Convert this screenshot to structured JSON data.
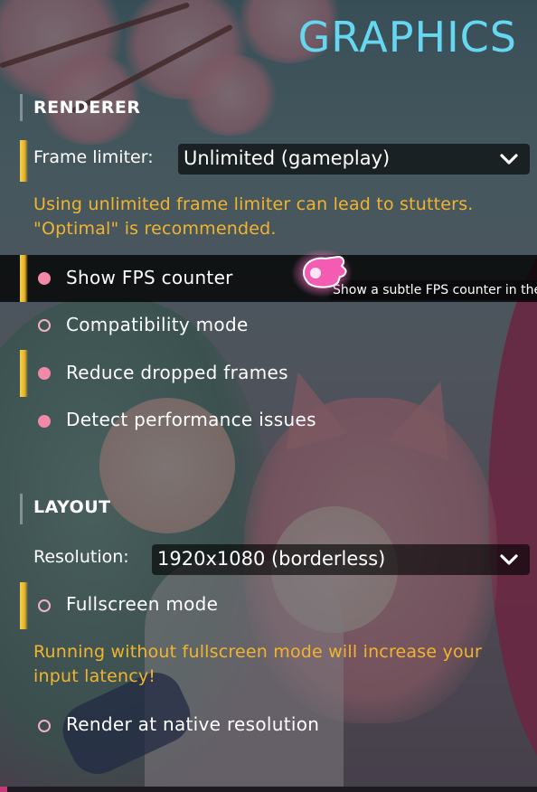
{
  "header": {
    "title": "GRAPHICS"
  },
  "renderer": {
    "section_label": "RENDERER",
    "frame_limiter": {
      "label": "Frame limiter:",
      "value": "Unlimited (gameplay)"
    },
    "warning": "Using unlimited frame limiter can lead to stutters. \"Optimal\" is recommended.",
    "options": [
      {
        "label": "Show FPS counter",
        "checked": true,
        "highlighted": true
      },
      {
        "label": "Compatibility mode",
        "checked": false
      },
      {
        "label": "Reduce dropped frames",
        "checked": true
      },
      {
        "label": "Detect performance issues",
        "checked": true
      }
    ],
    "tooltip": "Show a subtle FPS counter in the corner of the screen"
  },
  "layout": {
    "section_label": "LAYOUT",
    "resolution": {
      "label": "Resolution:",
      "value": "1920x1080 (borderless)"
    },
    "fullscreen": {
      "label": "Fullscreen mode",
      "checked": false
    },
    "warning": "Running without fullscreen mode will increase your input latency!",
    "native": {
      "label": "Render at native resolution",
      "checked": false
    }
  },
  "colors": {
    "title": "#66d7f0",
    "warning": "#f2b42f",
    "checkbox_on": "#f08aa8",
    "marker_bar": "#f6d24a"
  },
  "icons": {
    "dropdown": "chevron-down-icon",
    "cursor": "pink-glowing-cursor-icon"
  }
}
